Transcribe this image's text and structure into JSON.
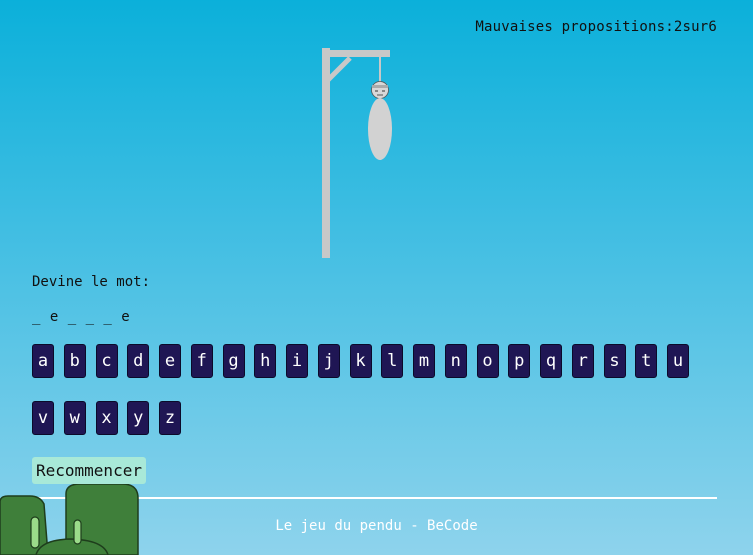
{
  "game": {
    "wrong_guesses_text": "Mauvaises propositions:2sur6",
    "prompt": "Devine le mot:",
    "word_display": "_ e _ _ _ e",
    "restart_label": "Recommencer",
    "footer_text": "Le jeu du pendu - BeCode"
  },
  "keyboard": {
    "letters": [
      "a",
      "b",
      "c",
      "d",
      "e",
      "f",
      "g",
      "h",
      "i",
      "j",
      "k",
      "l",
      "m",
      "n",
      "o",
      "p",
      "q",
      "r",
      "s",
      "t",
      "u",
      "v",
      "w",
      "x",
      "y",
      "z"
    ]
  },
  "colors": {
    "key_background": "#1f1654",
    "restart_background": "#a8e9d8",
    "gallows": "#c8c8c8",
    "figure": "#d2d2d2",
    "decor_green": "#3f7f3a",
    "decor_light_green": "#9bdb8a"
  },
  "icons": {
    "gallows": "gallows-icon",
    "hangman_figure": "hangman-figure-icon",
    "decor": "cactus-decor-icon"
  }
}
